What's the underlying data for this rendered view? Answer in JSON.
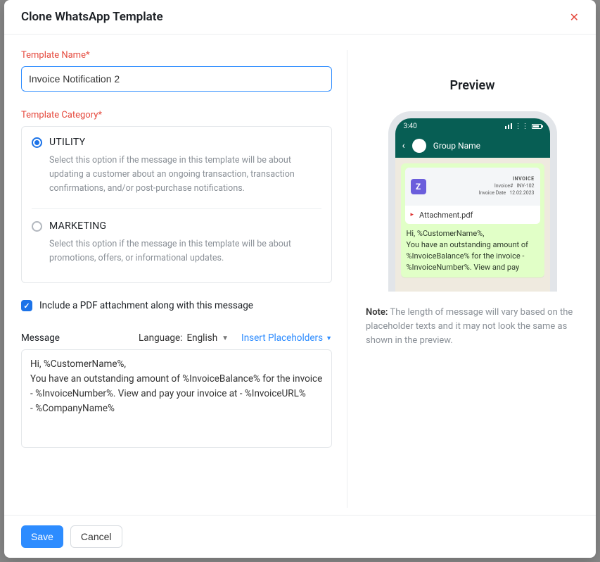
{
  "header": {
    "title": "Clone WhatsApp Template"
  },
  "form": {
    "name_label": "Template Name*",
    "name_value": "Invoice Notification 2",
    "category_label": "Template Category*",
    "categories": [
      {
        "title": "UTILITY",
        "desc": "Select this option if the message in this template will be about updating a customer about an ongoing transaction, transaction confirmations, and/or post-purchase notifications.",
        "selected": true
      },
      {
        "title": "MARKETING",
        "desc": "Select this option if the message in this template will be about promotions, offers, or informational updates.",
        "selected": false
      }
    ],
    "include_pdf_label": "Include a PDF attachment along with this message",
    "message_label": "Message",
    "language_label": "Language:",
    "language_value": "English",
    "insert_placeholders": "Insert Placeholders",
    "message_body": "Hi, %CustomerName%,\nYou have an outstanding amount of %InvoiceBalance% for the invoice - %InvoiceNumber%. View and pay your invoice at - %InvoiceURL%\n- %CompanyName%"
  },
  "preview": {
    "title": "Preview",
    "time": "3:40",
    "group_name": "Group Name",
    "invoice_word": "INVOICE",
    "invoice_no_label": "Invoice#",
    "invoice_no": "INV-102",
    "invoice_date_label": "Invoice Date",
    "invoice_date": "12.02.2023",
    "attachment_name": "Attachment.pdf",
    "bubble_lines": "Hi, %CustomerName%,\nYou have an outstanding amount of %InvoiceBalance% for the invoice - %InvoiceNumber%. View and pay",
    "note_label": "Note:",
    "note_text": " The length of message will vary based on the placeholder texts and it may not look the same as shown in the preview."
  },
  "footer": {
    "save": "Save",
    "cancel": "Cancel"
  }
}
